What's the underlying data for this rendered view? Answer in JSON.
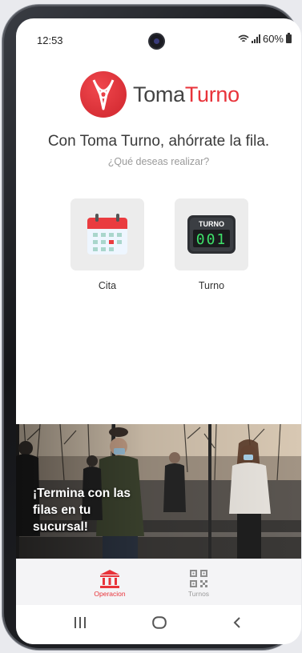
{
  "status": {
    "time": "12:53",
    "battery": "60%"
  },
  "brand": {
    "part1": "Toma",
    "part2": "Turno",
    "color": "#e8333a"
  },
  "headline": "Con Toma Turno, ahórrate la fila.",
  "subline": "¿Qué deseas realizar?",
  "options": [
    {
      "label": "Cita",
      "icon": "calendar-icon"
    },
    {
      "label": "Turno",
      "icon": "turn-ticket-icon",
      "display_title": "TURNO",
      "display_number": "001"
    }
  ],
  "banner": {
    "text": "¡Termina con las filas en tu sucursal!"
  },
  "tabs": [
    {
      "label": "Operacion",
      "icon": "bank-icon",
      "active": true
    },
    {
      "label": "Turnos",
      "icon": "qr-code-icon",
      "active": false
    }
  ],
  "nav": [
    "recent-apps-icon",
    "home-icon",
    "back-icon"
  ]
}
